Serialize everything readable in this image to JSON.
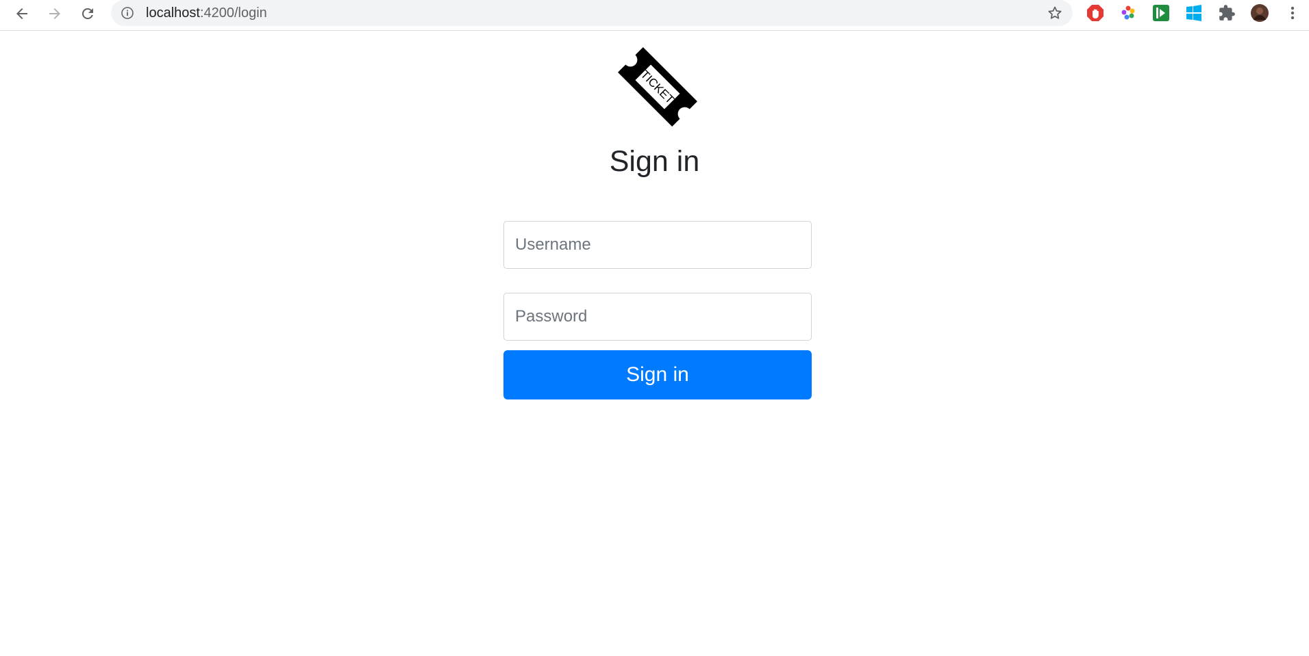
{
  "browser": {
    "url_host": "localhost",
    "url_path": ":4200/login",
    "icons": {
      "back": "arrow-left-icon",
      "forward": "arrow-right-icon",
      "reload": "reload-icon",
      "site_info": "info-icon",
      "bookmark": "star-icon",
      "extensions": [
        "adblock-icon",
        "colorful-pinwheel-icon",
        "green-play-icon",
        "windows-icon",
        "puzzle-icon",
        "profile-avatar",
        "more-vertical-icon"
      ]
    }
  },
  "login": {
    "logo_text": "TICKET",
    "title": "Sign in",
    "username_placeholder": "Username",
    "password_placeholder": "Password",
    "submit_label": "Sign in"
  },
  "colors": {
    "primary": "#007bff",
    "text": "#212529",
    "border": "#ced4da"
  }
}
